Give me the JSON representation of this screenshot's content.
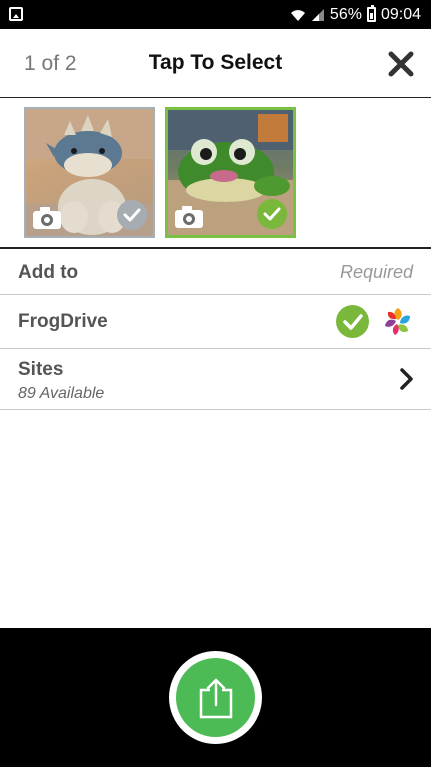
{
  "status_bar": {
    "battery": "56%",
    "time": "09:04"
  },
  "header": {
    "counter": "1 of 2",
    "title": "Tap To Select"
  },
  "thumbnails": [
    {
      "name": "dinosaur-plush-photo",
      "selected": false,
      "check_color": "#a5adb3"
    },
    {
      "name": "frog-plush-photo",
      "selected": true,
      "check_color": "#7ab83c"
    }
  ],
  "rows": {
    "add_to": {
      "label": "Add to",
      "hint": "Required"
    },
    "frogdrive": {
      "label": "FrogDrive",
      "checked": true
    },
    "sites": {
      "label": "Sites",
      "subtitle": "89 Available"
    }
  },
  "colors": {
    "accent_green": "#7ab83c",
    "share_green": "#4dbb55",
    "grey_check": "#a5adb3"
  },
  "icons": [
    "gallery-icon",
    "wifi-icon",
    "signal-icon",
    "battery-icon",
    "close-icon",
    "camera-icon",
    "check-icon",
    "frogdrive-logo-icon",
    "chevron-right-icon",
    "share-icon"
  ]
}
